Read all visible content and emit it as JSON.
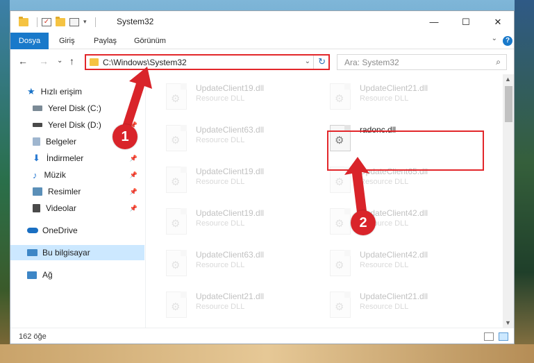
{
  "window": {
    "title": "System32",
    "minimize_label": "—",
    "maximize_label": "☐",
    "close_label": "✕"
  },
  "quick_access_toolbar": {
    "pin_symbol": "|",
    "dropdown_symbol": "▾"
  },
  "ribbon": {
    "tabs": [
      "Dosya",
      "Giriş",
      "Paylaş",
      "Görünüm"
    ],
    "help_label": "?",
    "collapse_symbol": "⌄"
  },
  "navigation": {
    "back_symbol": "←",
    "forward_symbol": "→",
    "recent_symbol": "⌄",
    "up_symbol": "↑",
    "address": "C:\\Windows\\System32",
    "address_dropdown_symbol": "⌄",
    "refresh_symbol": "↻",
    "search_placeholder": "Ara: System32",
    "search_icon_symbol": "⌕"
  },
  "sidebar": {
    "items": [
      {
        "label": "Hızlı erişim",
        "icon": "star-icon",
        "pinned": false,
        "color": "#1a73c7"
      },
      {
        "label": "Yerel Disk (C:)",
        "icon": "drive-icon",
        "pinned": true,
        "color": "#7b8a96"
      },
      {
        "label": "Yerel Disk (D:)",
        "icon": "drive-icon",
        "pinned": true,
        "color": "#4a4a4a"
      },
      {
        "label": "Belgeler",
        "icon": "documents-icon",
        "pinned": true,
        "color": "#9fb6cf"
      },
      {
        "label": "İndirmeler",
        "icon": "download-icon",
        "pinned": true,
        "color": "#2b7bd2"
      },
      {
        "label": "Müzik",
        "icon": "music-icon",
        "pinned": true,
        "color": "#2b7bd2"
      },
      {
        "label": "Resimler",
        "icon": "pictures-icon",
        "pinned": true,
        "color": "#5b8fb8"
      },
      {
        "label": "Videolar",
        "icon": "videos-icon",
        "pinned": true,
        "color": "#4a4a4a"
      },
      {
        "label": "OneDrive",
        "icon": "cloud-icon",
        "pinned": false,
        "color": "#1a6fc2"
      },
      {
        "label": "Bu bilgisayar",
        "icon": "computer-icon",
        "pinned": false,
        "color": "#3d86c6"
      },
      {
        "label": "Ağ",
        "icon": "network-icon",
        "pinned": false,
        "color": "#3d86c6"
      }
    ],
    "pin_symbol": "📌"
  },
  "files": [
    {
      "name": "UpdateClient19.dll",
      "type": "Resource DLL",
      "faded": true
    },
    {
      "name": "UpdateClient21.dll",
      "type": "Resource DLL",
      "faded": true
    },
    {
      "name": "UpdateClient63.dll",
      "type": "Resource DLL",
      "faded": true
    },
    {
      "name": "radonc.dll",
      "type": "",
      "faded": false
    },
    {
      "name": "UpdateClient19.dll",
      "type": "Resource DLL",
      "faded": true
    },
    {
      "name": "UpdateClient65.dll",
      "type": "Resource DLL",
      "faded": true
    },
    {
      "name": "UpdateClient19.dll",
      "type": "Resource DLL",
      "faded": true
    },
    {
      "name": "UpdateClient42.dll",
      "type": "Resource DLL",
      "faded": true
    },
    {
      "name": "UpdateClient63.dll",
      "type": "Resource DLL",
      "faded": true
    },
    {
      "name": "UpdateClient42.dll",
      "type": "Resource DLL",
      "faded": true
    },
    {
      "name": "UpdateClient21.dll",
      "type": "Resource DLL",
      "faded": true
    },
    {
      "name": "UpdateClient21.dll",
      "type": "Resource DLL",
      "faded": true
    }
  ],
  "status": {
    "item_count": "162 öğe"
  },
  "annotations": {
    "marker_1": "1",
    "marker_2": "2",
    "highlight_color": "#e2262a"
  },
  "scrollbar": {
    "up_symbol": "▲",
    "down_symbol": "▼"
  }
}
